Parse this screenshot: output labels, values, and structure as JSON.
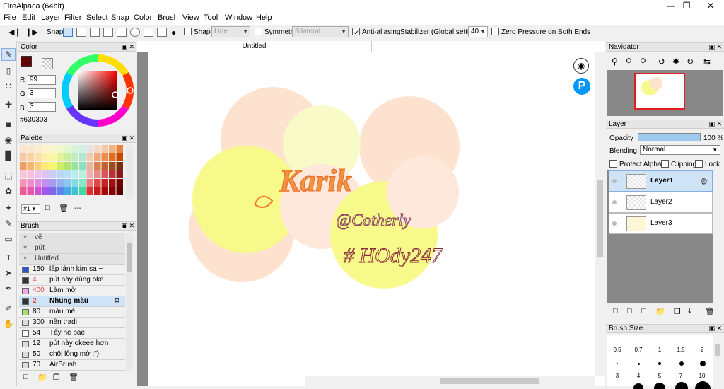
{
  "window": {
    "title": "FireAlpaca (64bit)"
  },
  "menu": [
    "File",
    "Edit",
    "Layer",
    "Filter",
    "Select",
    "Snap",
    "Color",
    "Brush",
    "View",
    "Tool",
    "Window",
    "Help"
  ],
  "toolbar": {
    "snap_label": "Snap",
    "shape_label": "Shape",
    "shape_value": "Line",
    "symmetry_label": "Symmetry",
    "symmetry_value": "Bilateral",
    "antialias_label": "Anti-aliasing",
    "stabilizer_label": "Stabilizer (Global settings)",
    "stabilizer_value": "40",
    "zero_pressure_label": "Zero Pressure on Both Ends"
  },
  "color_panel": {
    "title": "Color",
    "r": "99",
    "g": "3",
    "b": "3",
    "r_label": "R",
    "g_label": "G",
    "b_label": "B",
    "hex": "#630303",
    "foreground": "#630303"
  },
  "palette_panel": {
    "title": "Palette",
    "set": "#1",
    "more": "---"
  },
  "brush_panel": {
    "title": "Brush",
    "items": [
      {
        "size": "",
        "name": "vẽ",
        "group": true
      },
      {
        "size": "",
        "name": "pút",
        "group": true
      },
      {
        "size": "",
        "name": "Untitled",
        "group": true
      },
      {
        "size": "150",
        "name": "lấp lánh kim sa ~",
        "color": "#3355cc"
      },
      {
        "size": "4",
        "name": "pút này dùng oke",
        "color": "#333333"
      },
      {
        "size": "400",
        "name": "Làm mờ",
        "color": "#f4a6e8"
      },
      {
        "size": "2",
        "name": "Nhúng màu",
        "color": "#333333",
        "selected": true
      },
      {
        "size": "80",
        "name": "màu mè",
        "color": "#a7e06a"
      },
      {
        "size": "300",
        "name": "nền tradi",
        "color": "#dddddd"
      },
      {
        "size": "54",
        "name": "Tẩy nè bae ~",
        "color": "#ffffff"
      },
      {
        "size": "12",
        "name": "pút này okeee hơn",
        "color": "#dddddd"
      },
      {
        "size": "50",
        "name": "chôi lông mờ :\")",
        "color": "#dddddd"
      },
      {
        "size": "70",
        "name": "AirBrush",
        "color": "#dddddd"
      }
    ]
  },
  "canvas": {
    "tab": "Untitled",
    "art_text_1": "Karik",
    "art_text_2": "@Cotherly",
    "art_text_3": "# HOdy247"
  },
  "navigator": {
    "title": "Navigator"
  },
  "layer_panel": {
    "title": "Layer",
    "opacity_label": "Opacity",
    "opacity_value": "100 %",
    "opacity_level": 1.0,
    "blending_label": "Blending",
    "blending_value": "Normal",
    "protect_alpha": "Protect Alpha",
    "clipping": "Clipping",
    "lock": "Lock",
    "layers": [
      {
        "name": "Layer1",
        "selected": true
      },
      {
        "name": "Layer2",
        "selected": false
      },
      {
        "name": "Layer3",
        "selected": false
      }
    ]
  },
  "brush_size_panel": {
    "title": "Brush Size",
    "sizes_row1": [
      "0.5",
      "0.7",
      "1",
      "1.5",
      "2"
    ],
    "sizes_row2": [
      "3",
      "4",
      "5",
      "7",
      "10"
    ]
  }
}
